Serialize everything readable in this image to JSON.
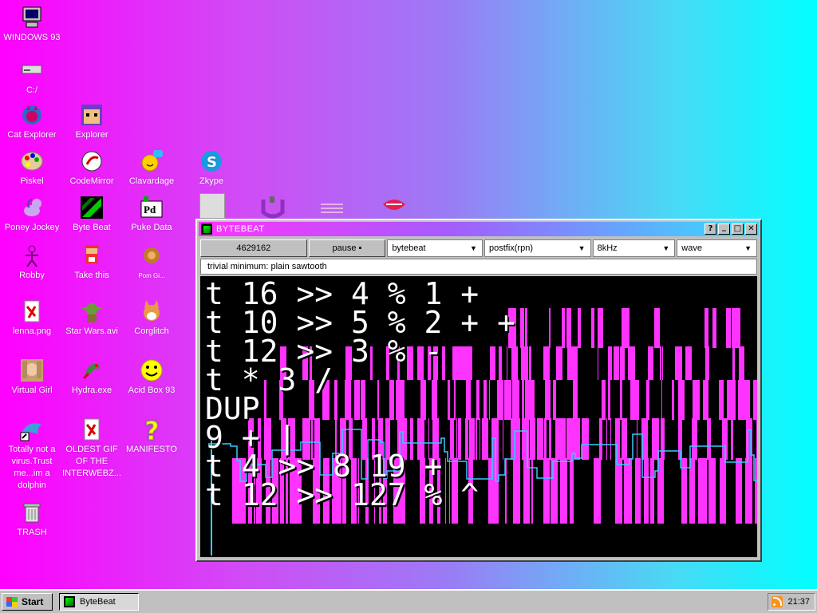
{
  "desktop": {
    "icons": [
      {
        "label": "WINDOWS 93",
        "icon": "computer-icon"
      },
      {
        "label": "C:/",
        "icon": "drive-icon"
      },
      {
        "label": "Cat Explorer",
        "icon": "cat-explorer-icon"
      },
      {
        "label": "Explorer",
        "icon": "explorer-icon"
      },
      {
        "label": "Piskel",
        "icon": "palette-icon"
      },
      {
        "label": "CodeMirror",
        "icon": "codemirror-icon"
      },
      {
        "label": "Clavardage",
        "icon": "chat-icon"
      },
      {
        "label": "Zkype",
        "icon": "zkype-icon"
      },
      {
        "label": "Poney Jockey",
        "icon": "pony-icon"
      },
      {
        "label": "Byte Beat",
        "icon": "bytebeat-icon"
      },
      {
        "label": "Puke Data",
        "icon": "pd-icon"
      },
      {
        "label": "Robby",
        "icon": "robby-icon"
      },
      {
        "label": "Take this",
        "icon": "take-this-icon"
      },
      {
        "label": "Pom Gi...",
        "icon": "pomgi-icon"
      },
      {
        "label": "lenna.png",
        "icon": "image-file-icon"
      },
      {
        "label": "Star Wars.avi",
        "icon": "yoda-icon"
      },
      {
        "label": "Corglitch",
        "icon": "corgi-icon"
      },
      {
        "label": "Virtual Girl",
        "icon": "virtual-girl-icon"
      },
      {
        "label": "Hydra.exe",
        "icon": "hydra-icon"
      },
      {
        "label": "Acid Box 93",
        "icon": "smiley-icon"
      },
      {
        "label": "Totally not a virus.Trust me...im a dolphin",
        "icon": "dolphin-icon"
      },
      {
        "label": "OLDEST GIF OF THE INTERWEBZ...",
        "icon": "gif-file-icon"
      },
      {
        "label": "MANIFESTO",
        "icon": "question-icon"
      },
      {
        "label": "TRASH",
        "icon": "trash-icon"
      }
    ]
  },
  "window": {
    "title": "BYTEBEAT",
    "controls": {
      "help": "?",
      "minimize": "_",
      "maximize": "□",
      "close": "✕"
    },
    "toolbar": {
      "counter": "4629162",
      "pause_label": "pause ▪",
      "mode": "bytebeat",
      "syntax": "postfix(rpn)",
      "rate": "8kHz",
      "view": "wave"
    },
    "hint": "trivial minimum: plain sawtooth",
    "code_lines": [
      "t 16 >> 4 % 1 +",
      "t 10 >> 5 % 2 + +",
      "t 12 >> 3 % -",
      "t * 3 /",
      "DUP",
      "9 + |",
      "t 4 >> 8 19 +",
      "t 12 >> 127 % ^"
    ]
  },
  "taskbar": {
    "start_label": "Start",
    "task_label": "ByteBeat",
    "clock": "21:37"
  },
  "colors": {
    "gradient_left": "#ff00ff",
    "gradient_right": "#00ffff",
    "viz_magenta": "#ff33ff",
    "viz_cyan": "#33ccff",
    "window_face": "#c0c0c0"
  }
}
